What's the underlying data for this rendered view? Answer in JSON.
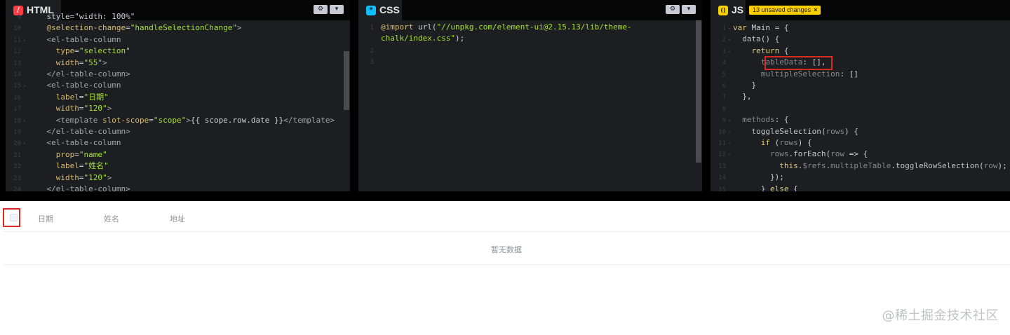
{
  "editors": {
    "html": {
      "title": "HTML",
      "badge": "/",
      "settings_icon": "gear-icon",
      "collapse_icon": "chevron-down-icon",
      "lines": [
        {
          "n": "9",
          "fold": "",
          "parts": [
            [
              "txt",
              "    style=\"width: 100%\""
            ]
          ]
        },
        {
          "n": "10",
          "fold": "",
          "parts": [
            [
              "txt",
              "    "
            ],
            [
              "attr",
              "@selection-change"
            ],
            [
              "txt",
              "="
            ],
            [
              "str",
              "\"handleSelectionChange\""
            ],
            [
              "tag",
              ">"
            ]
          ]
        },
        {
          "n": "11",
          "fold": "▾",
          "parts": [
            [
              "txt",
              "    "
            ],
            [
              "tag",
              "<el-table-column"
            ]
          ]
        },
        {
          "n": "12",
          "fold": "",
          "parts": [
            [
              "txt",
              "      "
            ],
            [
              "attr",
              "type"
            ],
            [
              "txt",
              "="
            ],
            [
              "str",
              "\"selection\""
            ]
          ]
        },
        {
          "n": "13",
          "fold": "",
          "parts": [
            [
              "txt",
              "      "
            ],
            [
              "attr",
              "width"
            ],
            [
              "txt",
              "="
            ],
            [
              "str",
              "\"55\""
            ],
            [
              "tag",
              ">"
            ]
          ]
        },
        {
          "n": "14",
          "fold": "",
          "parts": [
            [
              "txt",
              "    "
            ],
            [
              "tag",
              "</el-table-column>"
            ]
          ]
        },
        {
          "n": "15",
          "fold": "▾",
          "parts": [
            [
              "txt",
              "    "
            ],
            [
              "tag",
              "<el-table-column"
            ]
          ]
        },
        {
          "n": "16",
          "fold": "",
          "parts": [
            [
              "txt",
              "      "
            ],
            [
              "attr",
              "label"
            ],
            [
              "txt",
              "="
            ],
            [
              "str",
              "\"日期\""
            ]
          ]
        },
        {
          "n": "17",
          "fold": "",
          "parts": [
            [
              "txt",
              "      "
            ],
            [
              "attr",
              "width"
            ],
            [
              "txt",
              "="
            ],
            [
              "str",
              "\"120\""
            ],
            [
              "tag",
              ">"
            ]
          ]
        },
        {
          "n": "18",
          "fold": "▾",
          "parts": [
            [
              "txt",
              "      "
            ],
            [
              "tag",
              "<template "
            ],
            [
              "attr",
              "slot-scope"
            ],
            [
              "txt",
              "="
            ],
            [
              "str",
              "\"scope\""
            ],
            [
              "tag",
              ">"
            ],
            [
              "txt",
              "{{ scope.row.date }}"
            ],
            [
              "tag",
              "</template>"
            ]
          ]
        },
        {
          "n": "19",
          "fold": "",
          "parts": [
            [
              "txt",
              "    "
            ],
            [
              "tag",
              "</el-table-column>"
            ]
          ]
        },
        {
          "n": "20",
          "fold": "▾",
          "parts": [
            [
              "txt",
              "    "
            ],
            [
              "tag",
              "<el-table-column"
            ]
          ]
        },
        {
          "n": "21",
          "fold": "",
          "parts": [
            [
              "txt",
              "      "
            ],
            [
              "attr",
              "prop"
            ],
            [
              "txt",
              "="
            ],
            [
              "str",
              "\"name\""
            ]
          ]
        },
        {
          "n": "22",
          "fold": "",
          "parts": [
            [
              "txt",
              "      "
            ],
            [
              "attr",
              "label"
            ],
            [
              "txt",
              "="
            ],
            [
              "str",
              "\"姓名\""
            ]
          ]
        },
        {
          "n": "23",
          "fold": "",
          "parts": [
            [
              "txt",
              "      "
            ],
            [
              "attr",
              "width"
            ],
            [
              "txt",
              "="
            ],
            [
              "str",
              "\"120\""
            ],
            [
              "tag",
              ">"
            ]
          ]
        },
        {
          "n": "24",
          "fold": "",
          "parts": [
            [
              "tag",
              "    </el-table-column>"
            ]
          ]
        }
      ]
    },
    "css": {
      "title": "CSS",
      "badge": "*",
      "settings_icon": "gear-icon",
      "collapse_icon": "chevron-down-icon",
      "lines": [
        {
          "n": "1",
          "fold": "",
          "parts": [
            [
              "attr",
              "@import"
            ],
            [
              "txt",
              " url("
            ],
            [
              "str",
              "\"//unpkg.com/element-ui@2.15.13/lib/theme-"
            ]
          ]
        },
        {
          "n": "",
          "fold": "",
          "parts": [
            [
              "str",
              "chalk/index.css\""
            ],
            [
              "txt",
              ");"
            ]
          ]
        },
        {
          "n": "2",
          "fold": "",
          "parts": [
            [
              "txt",
              ""
            ]
          ]
        },
        {
          "n": "3",
          "fold": "",
          "parts": [
            [
              "txt",
              ""
            ]
          ]
        }
      ]
    },
    "js": {
      "title": "JS",
      "badge": "()",
      "unsaved_label": "13 unsaved changes",
      "unsaved_close": "×",
      "lines": [
        {
          "n": "1",
          "fold": "▾",
          "parts": [
            [
              "kw",
              "var"
            ],
            [
              "txt",
              " Main = {"
            ]
          ]
        },
        {
          "n": "2",
          "fold": "▾",
          "parts": [
            [
              "txt",
              "  "
            ],
            [
              "fn",
              "data"
            ],
            [
              "txt",
              "() {"
            ]
          ]
        },
        {
          "n": "3",
          "fold": "▾",
          "parts": [
            [
              "txt",
              "    "
            ],
            [
              "kw",
              "return"
            ],
            [
              "txt",
              " {"
            ]
          ]
        },
        {
          "n": "4",
          "fold": "",
          "parts": [
            [
              "txt",
              "      "
            ],
            [
              "mut",
              "tableData"
            ],
            [
              "txt",
              ": [],"
            ]
          ]
        },
        {
          "n": "5",
          "fold": "",
          "parts": [
            [
              "txt",
              "      "
            ],
            [
              "mut",
              "multipleSelection"
            ],
            [
              "txt",
              ": []"
            ]
          ]
        },
        {
          "n": "6",
          "fold": "",
          "parts": [
            [
              "txt",
              "    }"
            ]
          ]
        },
        {
          "n": "7",
          "fold": "",
          "parts": [
            [
              "txt",
              "  },"
            ]
          ]
        },
        {
          "n": "8",
          "fold": "",
          "parts": [
            [
              "txt",
              ""
            ]
          ]
        },
        {
          "n": "9",
          "fold": "▾",
          "parts": [
            [
              "txt",
              "  "
            ],
            [
              "mut",
              "methods"
            ],
            [
              "txt",
              ": {"
            ]
          ]
        },
        {
          "n": "10",
          "fold": "▾",
          "parts": [
            [
              "txt",
              "    "
            ],
            [
              "fn",
              "toggleSelection"
            ],
            [
              "txt",
              "("
            ],
            [
              "mut",
              "rows"
            ],
            [
              "txt",
              ") {"
            ]
          ]
        },
        {
          "n": "11",
          "fold": "▾",
          "parts": [
            [
              "txt",
              "      "
            ],
            [
              "kw",
              "if"
            ],
            [
              "txt",
              " ("
            ],
            [
              "mut",
              "rows"
            ],
            [
              "txt",
              ") {"
            ]
          ]
        },
        {
          "n": "12",
          "fold": "▾",
          "parts": [
            [
              "txt",
              "        "
            ],
            [
              "mut",
              "rows"
            ],
            [
              "txt",
              "."
            ],
            [
              "fn",
              "forEach"
            ],
            [
              "txt",
              "("
            ],
            [
              "mut",
              "row"
            ],
            [
              "txt",
              " => {"
            ]
          ]
        },
        {
          "n": "13",
          "fold": "",
          "parts": [
            [
              "txt",
              "          "
            ],
            [
              "kw",
              "this"
            ],
            [
              "txt",
              "."
            ],
            [
              "mut",
              "$refs"
            ],
            [
              "txt",
              "."
            ],
            [
              "mut",
              "multipleTable"
            ],
            [
              "txt",
              "."
            ],
            [
              "fn",
              "toggleRowSelection"
            ],
            [
              "txt",
              "("
            ],
            [
              "mut",
              "row"
            ],
            [
              "txt",
              ");"
            ]
          ]
        },
        {
          "n": "14",
          "fold": "",
          "parts": [
            [
              "txt",
              "        });"
            ]
          ]
        },
        {
          "n": "15",
          "fold": "",
          "parts": [
            [
              "txt",
              "      } "
            ],
            [
              "kw",
              "else"
            ],
            [
              "txt",
              " {"
            ]
          ]
        }
      ]
    }
  },
  "table": {
    "headers": [
      "日期",
      "姓名",
      "地址"
    ],
    "empty_text": "暂无数据"
  },
  "watermark": "@稀土掘金技术社区",
  "colors": {
    "highlight": "#d72a25",
    "editor_bg": "#1d1e22",
    "unsaved_bg": "#fcd000"
  }
}
